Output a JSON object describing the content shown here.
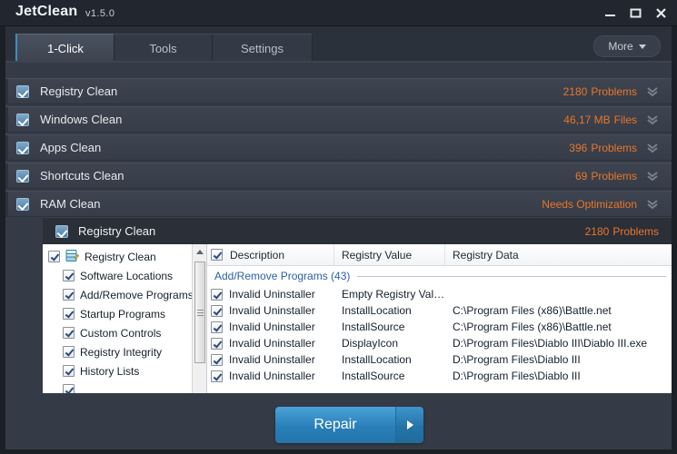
{
  "window": {
    "title": "JetClean",
    "version": "v1.5.0",
    "controls": [
      {
        "name": "minimize",
        "glyph": "minimize-icon"
      },
      {
        "name": "maximize",
        "glyph": "maximize-icon"
      },
      {
        "name": "close",
        "glyph": "close-icon"
      }
    ]
  },
  "tabs": [
    {
      "label": "1-Click",
      "active": true
    },
    {
      "label": "Tools",
      "active": false
    },
    {
      "label": "Settings",
      "active": false
    }
  ],
  "more_button": {
    "label": "More",
    "icon": "chevron-down-icon"
  },
  "rows": [
    {
      "label": "Registry Clean",
      "count": "2180",
      "unit": "Problems",
      "checked": true,
      "icon": "double-chevron-down-icon"
    },
    {
      "label": "Windows Clean",
      "count": "46,17 MB",
      "unit": "Files",
      "checked": true,
      "icon": "double-chevron-down-icon"
    },
    {
      "label": "Apps Clean",
      "count": "396",
      "unit": "Problems",
      "checked": true,
      "icon": "double-chevron-down-icon"
    },
    {
      "label": "Shortcuts Clean",
      "count": "69",
      "unit": "Problems",
      "checked": true,
      "icon": "double-chevron-down-icon"
    },
    {
      "label": "RAM Clean",
      "count": "",
      "unit": "Needs Optimization",
      "checked": true,
      "icon": "double-chevron-down-icon"
    }
  ],
  "detail": {
    "title": "Registry Clean",
    "count": "2180",
    "unit": "Problems",
    "checked": true,
    "tree": [
      {
        "label": "Registry Clean",
        "level": "root",
        "checked": true,
        "icon": "registry-icon"
      },
      {
        "label": "Software Locations",
        "level": "child",
        "checked": true
      },
      {
        "label": "Add/Remove Programs",
        "level": "child",
        "checked": true
      },
      {
        "label": "Startup Programs",
        "level": "child",
        "checked": true
      },
      {
        "label": "Custom Controls",
        "level": "child",
        "checked": true
      },
      {
        "label": "Registry Integrity",
        "level": "child",
        "checked": true
      },
      {
        "label": "History Lists",
        "level": "child",
        "checked": true
      }
    ],
    "columns": [
      "Description",
      "Registry Value",
      "Registry Data"
    ],
    "group": "Add/Remove Programs (43)",
    "items": [
      {
        "description": "Invalid Uninstaller",
        "value": "Empty Registry Value",
        "data": "",
        "checked": true
      },
      {
        "description": "Invalid Uninstaller",
        "value": "InstallLocation",
        "data": "C:\\Program Files (x86)\\Battle.net",
        "checked": true
      },
      {
        "description": "Invalid Uninstaller",
        "value": "InstallSource",
        "data": "C:\\Program Files (x86)\\Battle.net",
        "checked": true
      },
      {
        "description": "Invalid Uninstaller",
        "value": "DisplayIcon",
        "data": "D:\\Program Files\\Diablo III\\Diablo III.exe",
        "checked": true
      },
      {
        "description": "Invalid Uninstaller",
        "value": "InstallLocation",
        "data": "D:\\Program Files\\Diablo III",
        "checked": true
      },
      {
        "description": "Invalid Uninstaller",
        "value": "InstallSource",
        "data": "D:\\Program Files\\Diablo III",
        "checked": true
      }
    ]
  },
  "repair_button": {
    "label": "Repair",
    "icon": "arrow-right-icon"
  },
  "colors": {
    "accent_orange": "#e8762a",
    "accent_blue": "#3a8fc4",
    "window_bg": "#2f3540",
    "content_bg": "#353b46",
    "link_blue": "#2a5eaa"
  }
}
